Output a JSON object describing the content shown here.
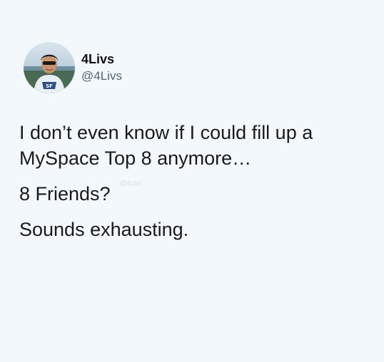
{
  "author": {
    "display_name": "4Livs",
    "handle": "@4Livs"
  },
  "tweet": {
    "paragraphs": [
      "I don’t even know if I could fill up a MySpace Top 8 anymore…",
      "8 Friends?",
      "Sounds exhausting."
    ]
  },
  "watermark": "@4Livs",
  "colors": {
    "background": "#f2f8fc",
    "handle": "#536471",
    "text": "#1a1a1a"
  }
}
